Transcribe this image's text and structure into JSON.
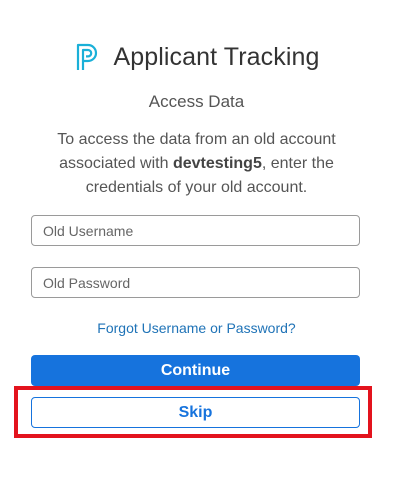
{
  "header": {
    "logo_icon": "powerschool-p-logo-icon",
    "title": "Applicant Tracking"
  },
  "page": {
    "subtitle": "Access Data",
    "description_before": "To access the data from an old account associated with ",
    "account_name": "devtesting5",
    "description_after": ", enter the credentials of your old account."
  },
  "form": {
    "username_placeholder": "Old Username",
    "username_value": "",
    "password_placeholder": "Old Password",
    "password_value": "",
    "forgot_link": "Forgot Username or Password?",
    "continue_label": "Continue",
    "skip_label": "Skip"
  },
  "colors": {
    "brand_blue": "#1673dd",
    "link_blue": "#1f73b7",
    "highlight_red": "#e3131d",
    "logo_cyan": "#1ab0d8"
  }
}
